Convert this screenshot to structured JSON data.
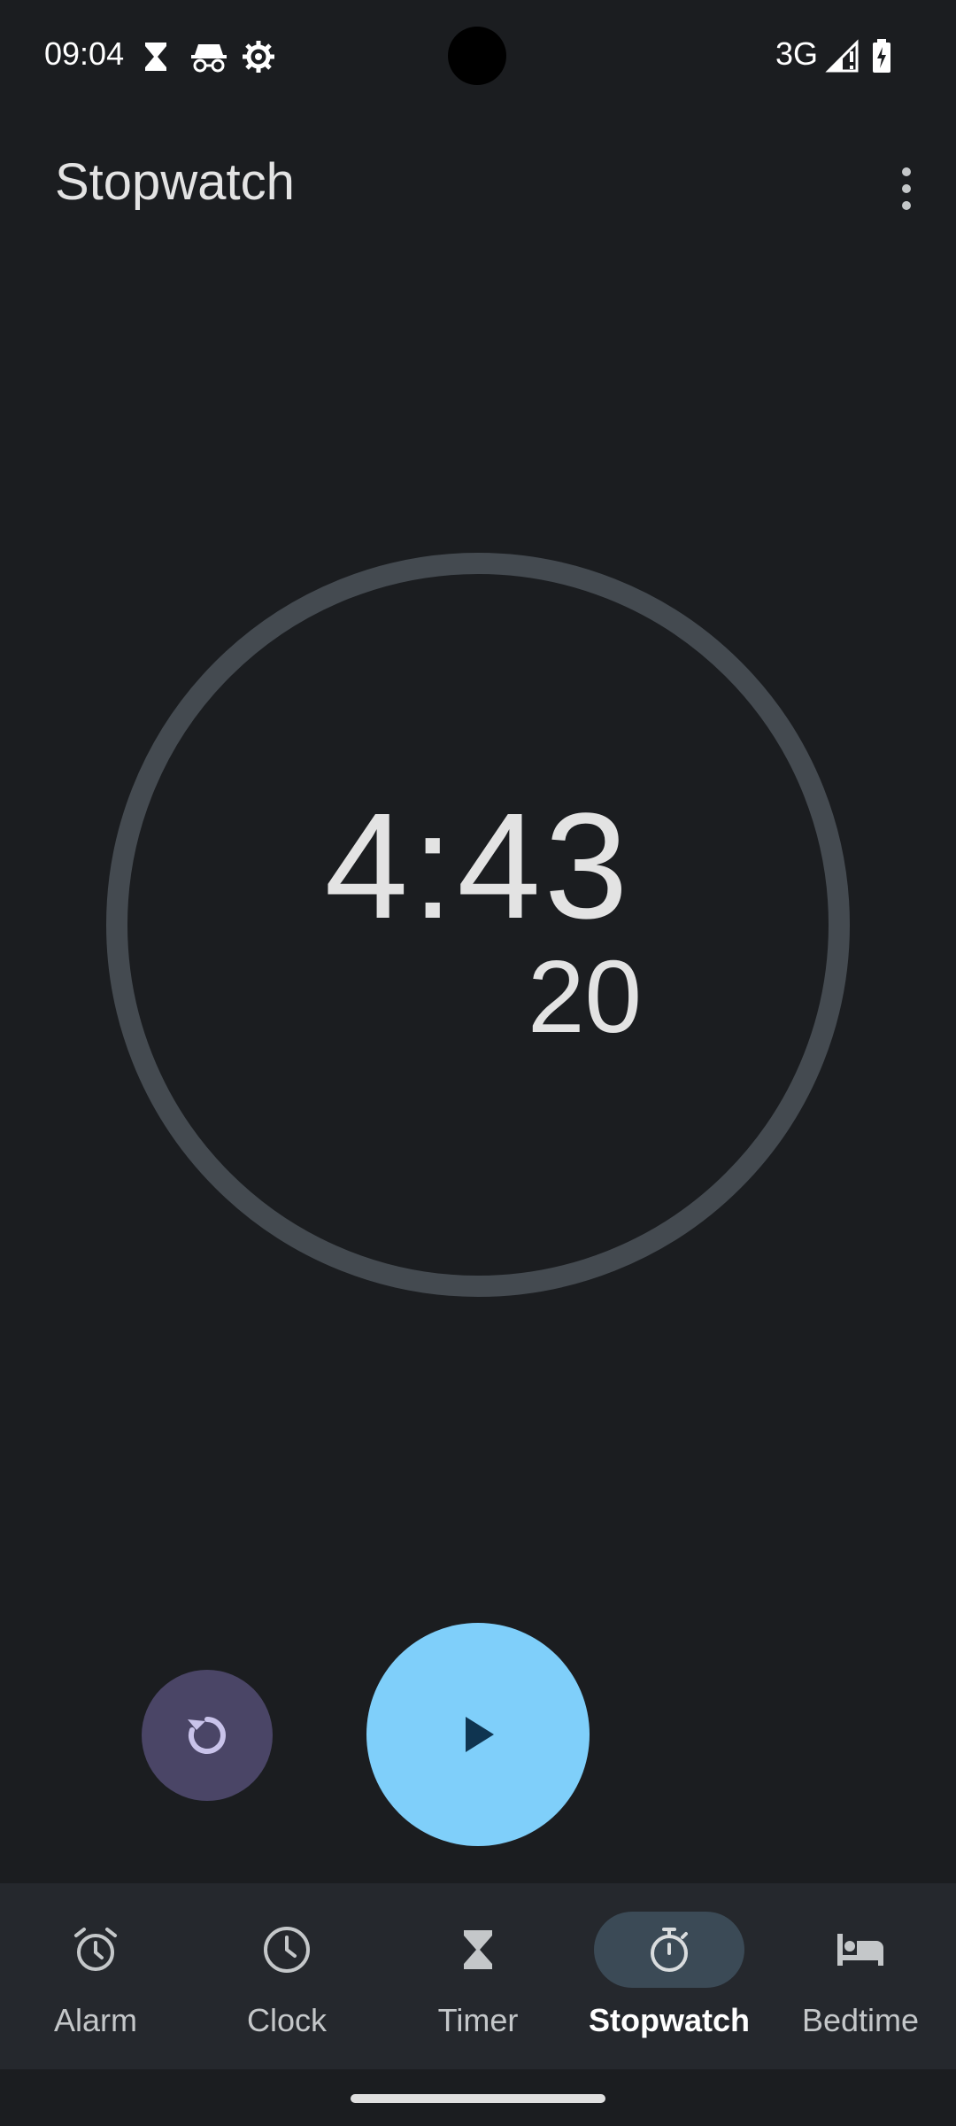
{
  "status_bar": {
    "time": "09:04",
    "network": "3G",
    "icons": [
      "hourglass-icon",
      "incognito-icon",
      "settings-gear-icon",
      "signal-icon",
      "battery-charging-icon"
    ]
  },
  "app": {
    "title": "Stopwatch"
  },
  "stopwatch": {
    "elapsed_main": "4:43",
    "elapsed_hundredths": "20",
    "ring_color": "#444a50"
  },
  "controls": {
    "reset_icon": "reset-icon",
    "play_icon": "play-icon",
    "reset_color": "#4a4566",
    "play_color": "#7fcffa"
  },
  "nav": {
    "items": [
      {
        "label": "Alarm",
        "icon": "alarm-icon"
      },
      {
        "label": "Clock",
        "icon": "clock-icon"
      },
      {
        "label": "Timer",
        "icon": "hourglass-icon"
      },
      {
        "label": "Stopwatch",
        "icon": "stopwatch-icon",
        "active": true
      },
      {
        "label": "Bedtime",
        "icon": "bed-icon"
      }
    ]
  }
}
